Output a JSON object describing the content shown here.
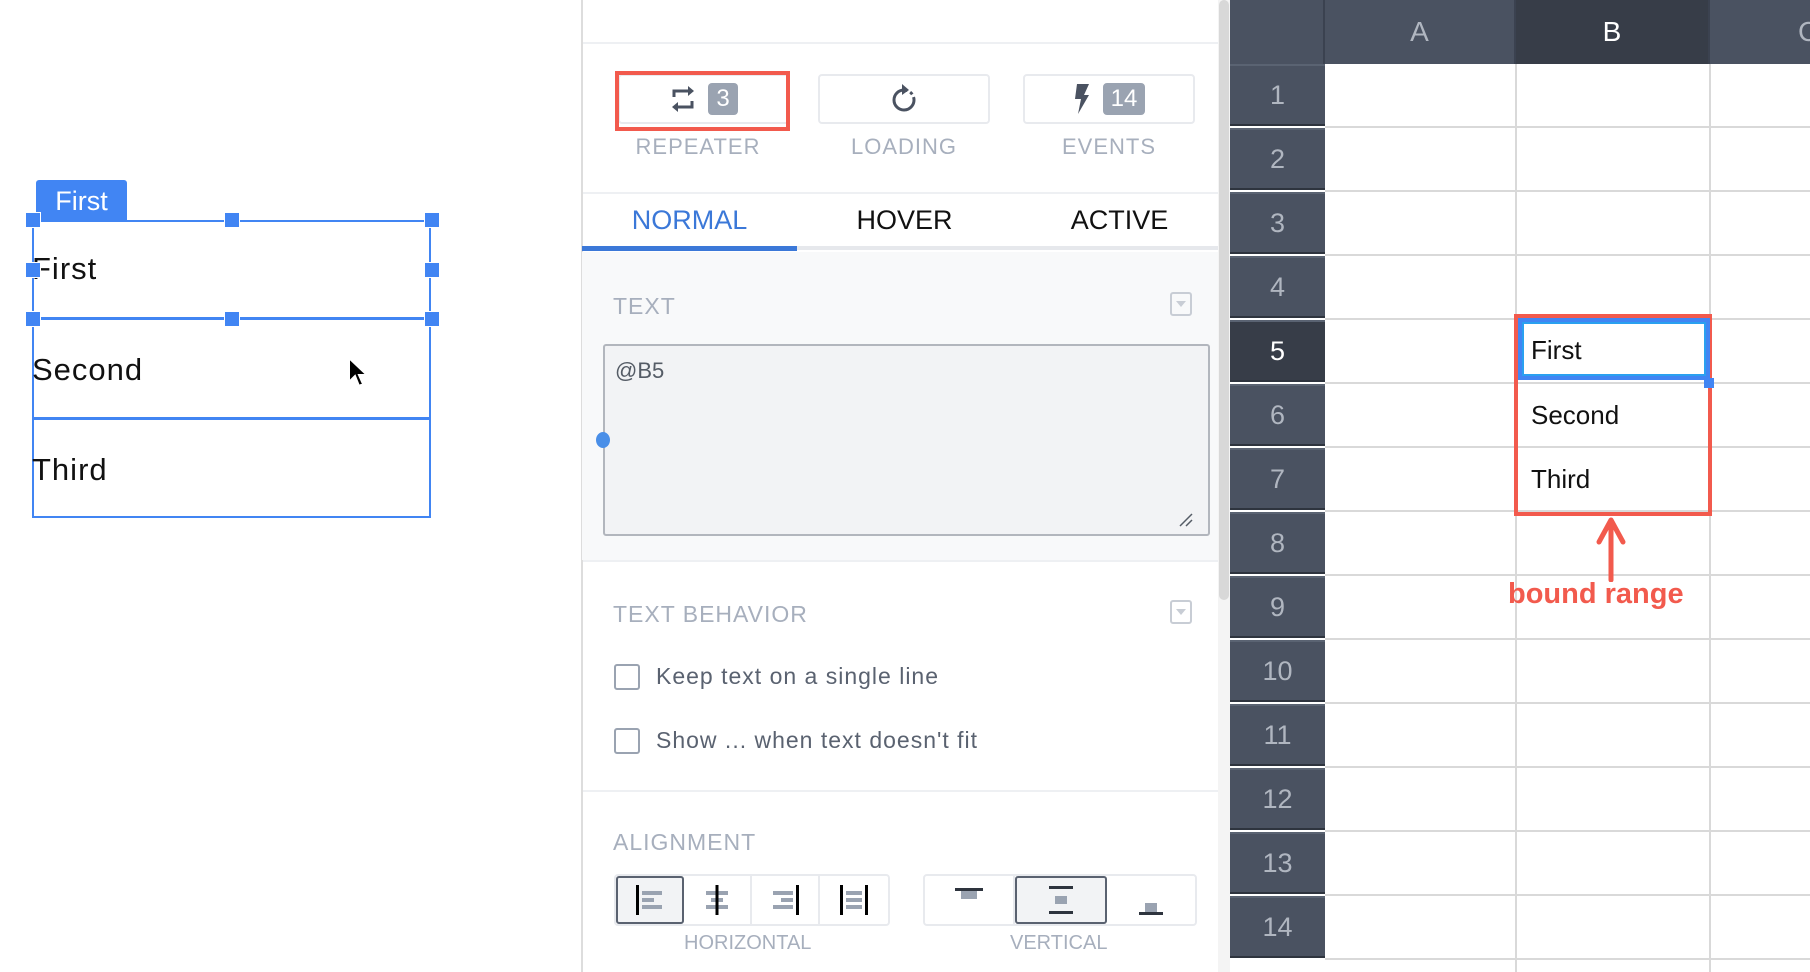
{
  "canvas": {
    "selection_tag": "First",
    "rows": [
      "First",
      "Second",
      "Third"
    ]
  },
  "panel": {
    "top_buttons": [
      {
        "icon": "repeat-icon",
        "label": "REPEATER",
        "badge": "3",
        "highlighted": true
      },
      {
        "icon": "loading-icon",
        "label": "LOADING",
        "badge": null,
        "highlighted": false
      },
      {
        "icon": "lightning-icon",
        "label": "EVENTS",
        "badge": "14",
        "highlighted": false
      }
    ],
    "tabs": [
      {
        "label": "NORMAL",
        "active": true
      },
      {
        "label": "HOVER",
        "active": false
      },
      {
        "label": "ACTIVE",
        "active": false
      }
    ],
    "text_section": {
      "title": "TEXT",
      "value": "@B5"
    },
    "text_behavior": {
      "title": "TEXT BEHAVIOR",
      "options": [
        {
          "label": "Keep text on a single line",
          "checked": false
        },
        {
          "label": "Show ... when text doesn't fit",
          "checked": false
        }
      ]
    },
    "alignment": {
      "title": "ALIGNMENT",
      "horizontal_label": "HORIZONTAL",
      "vertical_label": "VERTICAL",
      "horizontal_options": [
        "align-left",
        "align-center",
        "align-right",
        "justify"
      ],
      "horizontal_selected": "align-left",
      "vertical_options": [
        "align-top",
        "align-middle",
        "align-bottom"
      ],
      "vertical_selected": "align-middle"
    }
  },
  "sheet": {
    "columns": [
      "A",
      "B",
      "C"
    ],
    "selected_column": "B",
    "rows": [
      "1",
      "2",
      "3",
      "4",
      "5",
      "6",
      "7",
      "8",
      "9",
      "10",
      "11",
      "12",
      "13",
      "14"
    ],
    "selected_row": "5",
    "cells": {
      "B5": "First",
      "B6": "Second",
      "B7": "Third"
    },
    "annotation": "bound range",
    "colors": {
      "accent": "#4185f3",
      "annotation": "#f25a4d",
      "header_bg": "#4a5261"
    }
  }
}
